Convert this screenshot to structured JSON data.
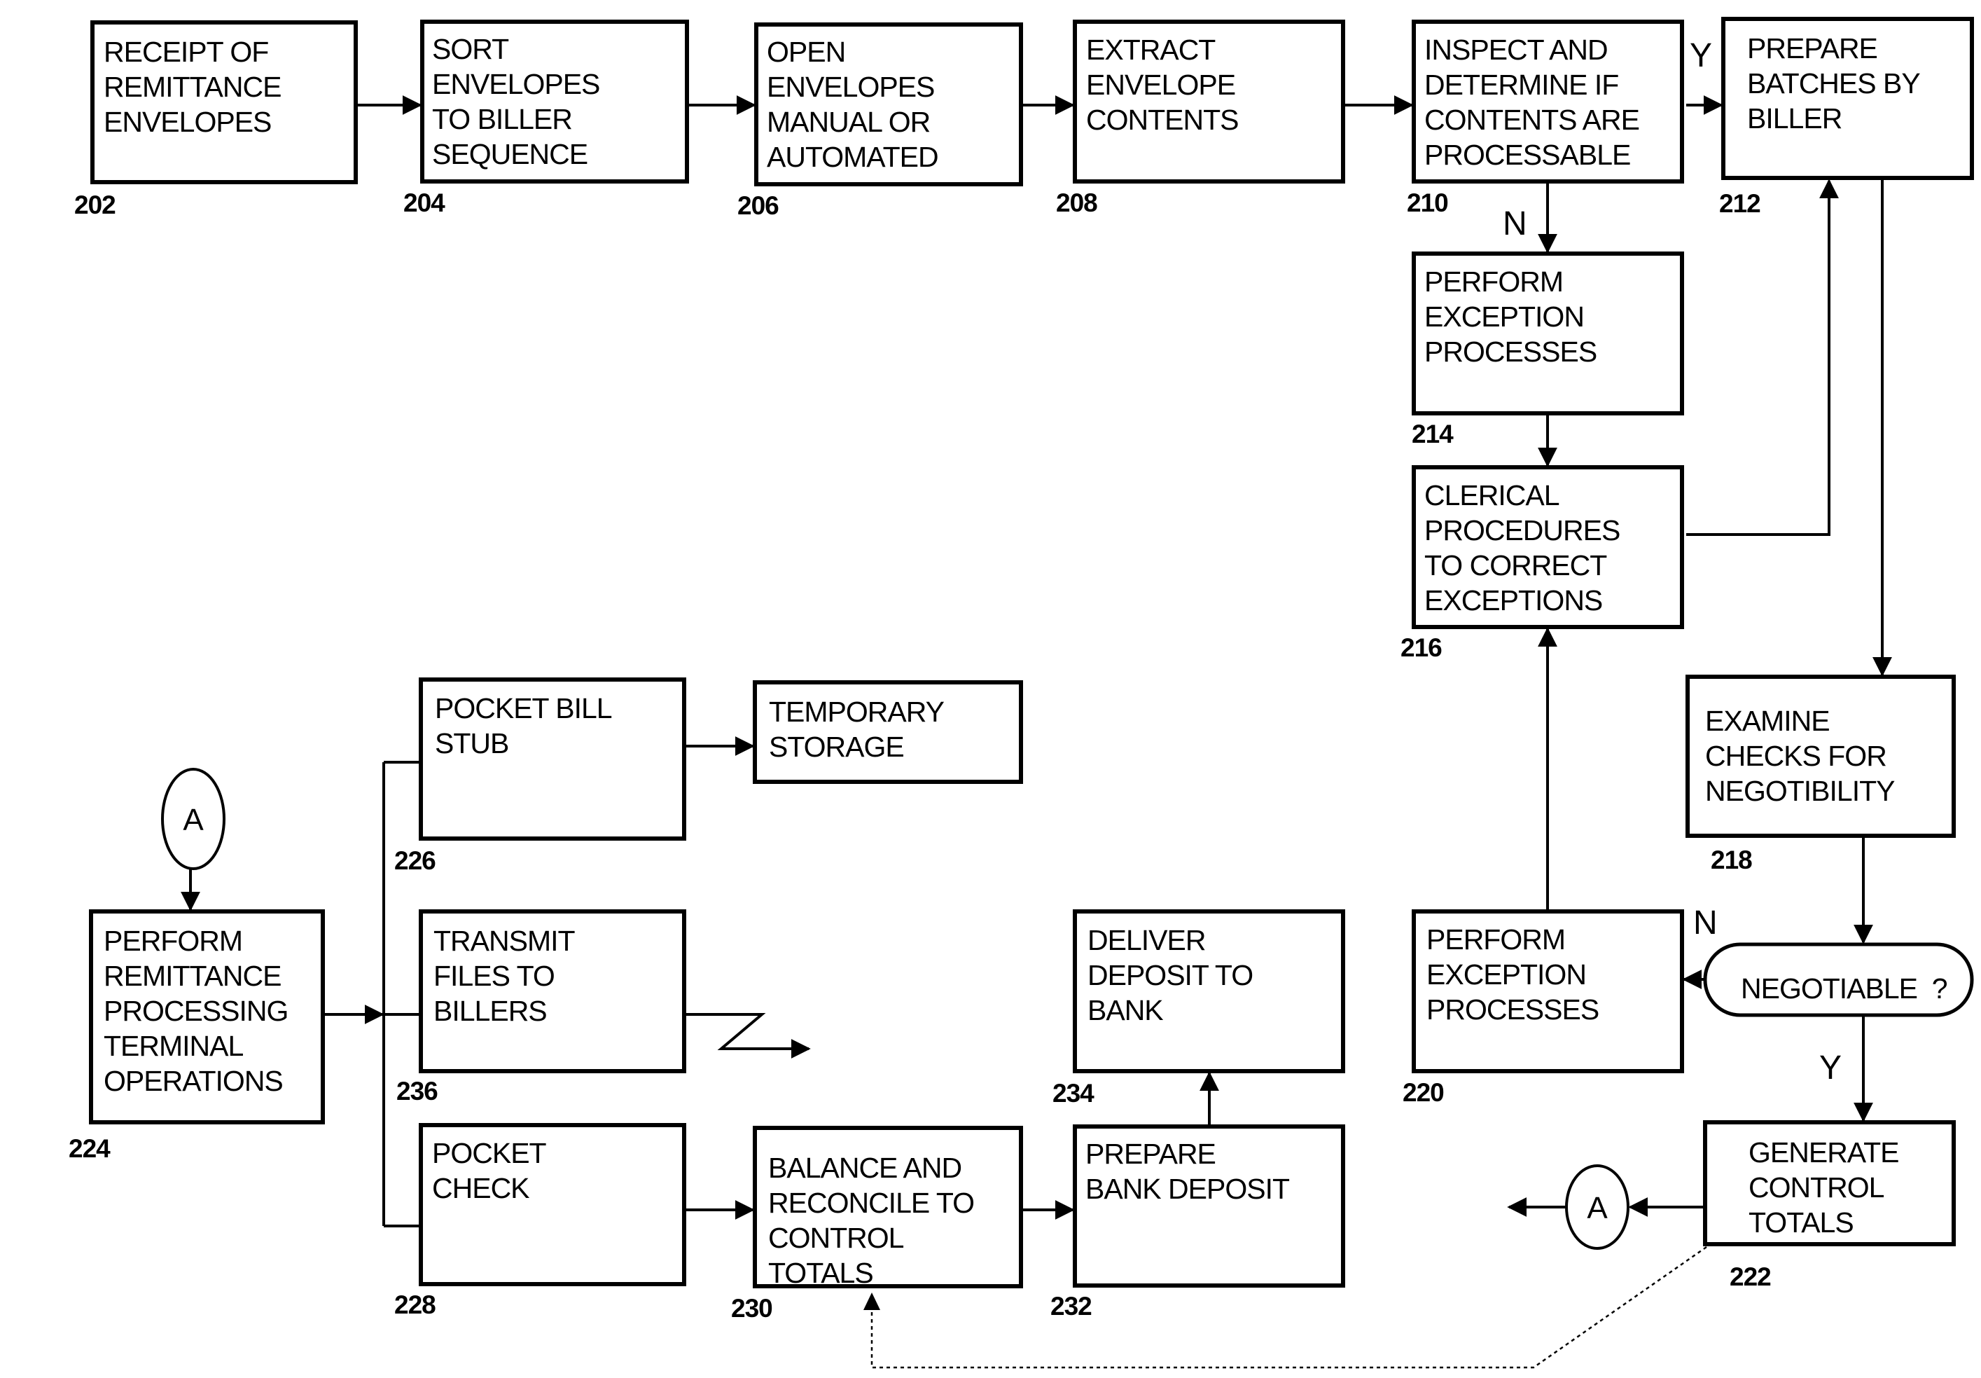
{
  "diagram": {
    "type": "flowchart",
    "nodes": [
      {
        "id": "202",
        "ref": "202",
        "lines": [
          "RECEIPT OF",
          "REMITTANCE",
          "ENVELOPES"
        ]
      },
      {
        "id": "204",
        "ref": "204",
        "lines": [
          "SORT",
          "ENVELOPES",
          "TO BILLER",
          "SEQUENCE"
        ]
      },
      {
        "id": "206",
        "ref": "206",
        "lines": [
          "OPEN",
          "ENVELOPES",
          "MANUAL OR",
          "AUTOMATED"
        ]
      },
      {
        "id": "208",
        "ref": "208",
        "lines": [
          "EXTRACT",
          "ENVELOPE",
          "CONTENTS"
        ]
      },
      {
        "id": "210",
        "ref": "210",
        "lines": [
          "INSPECT AND",
          "DETERMINE IF",
          "CONTENTS ARE",
          "PROCESSABLE"
        ]
      },
      {
        "id": "212",
        "ref": "212",
        "lines": [
          "PREPARE",
          "BATCHES BY",
          "BILLER"
        ]
      },
      {
        "id": "214",
        "ref": "214",
        "lines": [
          "PERFORM",
          "EXCEPTION",
          "PROCESSES"
        ]
      },
      {
        "id": "216",
        "ref": "216",
        "lines": [
          "CLERICAL",
          "PROCEDURES",
          "TO CORRECT",
          "EXCEPTIONS"
        ]
      },
      {
        "id": "218",
        "ref": "218",
        "lines": [
          "EXAMINE",
          "CHECKS FOR",
          "NEGOTIBILITY"
        ]
      },
      {
        "id": "negotiable",
        "ref": "",
        "lines": [
          "NEGOTIABLE  ?"
        ]
      },
      {
        "id": "220",
        "ref": "220",
        "lines": [
          "PERFORM",
          "EXCEPTION",
          "PROCESSES"
        ]
      },
      {
        "id": "222",
        "ref": "222",
        "lines": [
          "GENERATE",
          "CONTROL",
          "TOTALS"
        ]
      },
      {
        "id": "224",
        "ref": "224",
        "lines": [
          "PERFORM",
          "REMITTANCE",
          "PROCESSING",
          "TERMINAL",
          "OPERATIONS"
        ]
      },
      {
        "id": "226",
        "ref": "226",
        "lines": [
          "POCKET BILL",
          "STUB"
        ]
      },
      {
        "id": "temp",
        "ref": "",
        "lines": [
          "TEMPORARY",
          "STORAGE"
        ]
      },
      {
        "id": "236",
        "ref": "236",
        "lines": [
          "TRANSMIT",
          "FILES TO",
          "BILLERS"
        ]
      },
      {
        "id": "228",
        "ref": "228",
        "lines": [
          "POCKET",
          "CHECK"
        ]
      },
      {
        "id": "230",
        "ref": "230",
        "lines": [
          "BALANCE AND",
          "RECONCILE TO",
          "CONTROL",
          "TOTALS"
        ]
      },
      {
        "id": "232",
        "ref": "232",
        "lines": [
          "PREPARE",
          "BANK DEPOSIT"
        ]
      },
      {
        "id": "234",
        "ref": "234",
        "lines": [
          "DELIVER",
          "DEPOSIT TO",
          "BANK"
        ]
      }
    ],
    "connectors": {
      "a_out": "A",
      "a_in": "A"
    },
    "branch_labels": {
      "inspect_yes": "Y",
      "inspect_no": "N",
      "negotiable_no": "N",
      "negotiable_yes": "Y"
    }
  }
}
